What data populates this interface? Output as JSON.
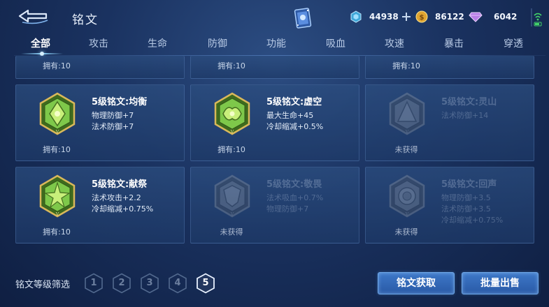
{
  "header": {
    "title": "铭文",
    "currencies": [
      {
        "name": "diamond",
        "value": "44938"
      },
      {
        "name": "gold-coin",
        "value": "86122"
      },
      {
        "name": "gem",
        "value": "6042"
      }
    ]
  },
  "tabs": [
    {
      "label": "全部",
      "active": true
    },
    {
      "label": "攻击"
    },
    {
      "label": "生命"
    },
    {
      "label": "防御"
    },
    {
      "label": "功能"
    },
    {
      "label": "吸血"
    },
    {
      "label": "攻速"
    },
    {
      "label": "暴击"
    },
    {
      "label": "穿透"
    }
  ],
  "top_row_owned": [
    "拥有:10",
    "拥有:10",
    "拥有:10"
  ],
  "cards": [
    {
      "name": "5级铭文:均衡",
      "stats": [
        "物理防御+7",
        "法术防御+7"
      ],
      "owned": "拥有:10",
      "locked": false,
      "color": "#7ec84a"
    },
    {
      "name": "5级铭文:虚空",
      "stats": [
        "最大生命+45",
        "冷却缩减+0.5%"
      ],
      "owned": "拥有:10",
      "locked": false,
      "color": "#7ec84a"
    },
    {
      "name": "5级铭文:灵山",
      "stats": [
        "法术防御+14"
      ],
      "owned": "未获得",
      "locked": true,
      "color": "#7ec84a"
    },
    {
      "name": "5级铭文:献祭",
      "stats": [
        "法术攻击+2.2",
        "冷却缩减+0.75%"
      ],
      "owned": "拥有:10",
      "locked": false,
      "color": "#7ec84a"
    },
    {
      "name": "5级铭文:敬畏",
      "stats": [
        "法术吸血+0.7%",
        "物理防御+7"
      ],
      "owned": "未获得",
      "locked": true,
      "color": "#7ec84a"
    },
    {
      "name": "5级铭文:回声",
      "stats": [
        "物理防御+3.5",
        "法术防御+3.5",
        "冷却缩减+0.75%"
      ],
      "owned": "未获得",
      "locked": true,
      "color": "#7ec84a"
    }
  ],
  "filter": {
    "label": "铭文等级筛选",
    "levels": [
      "1",
      "2",
      "3",
      "4",
      "5"
    ],
    "active_level": "5"
  },
  "actions": {
    "obtain_label": "铭文获取",
    "sell_label": "批量出售"
  }
}
